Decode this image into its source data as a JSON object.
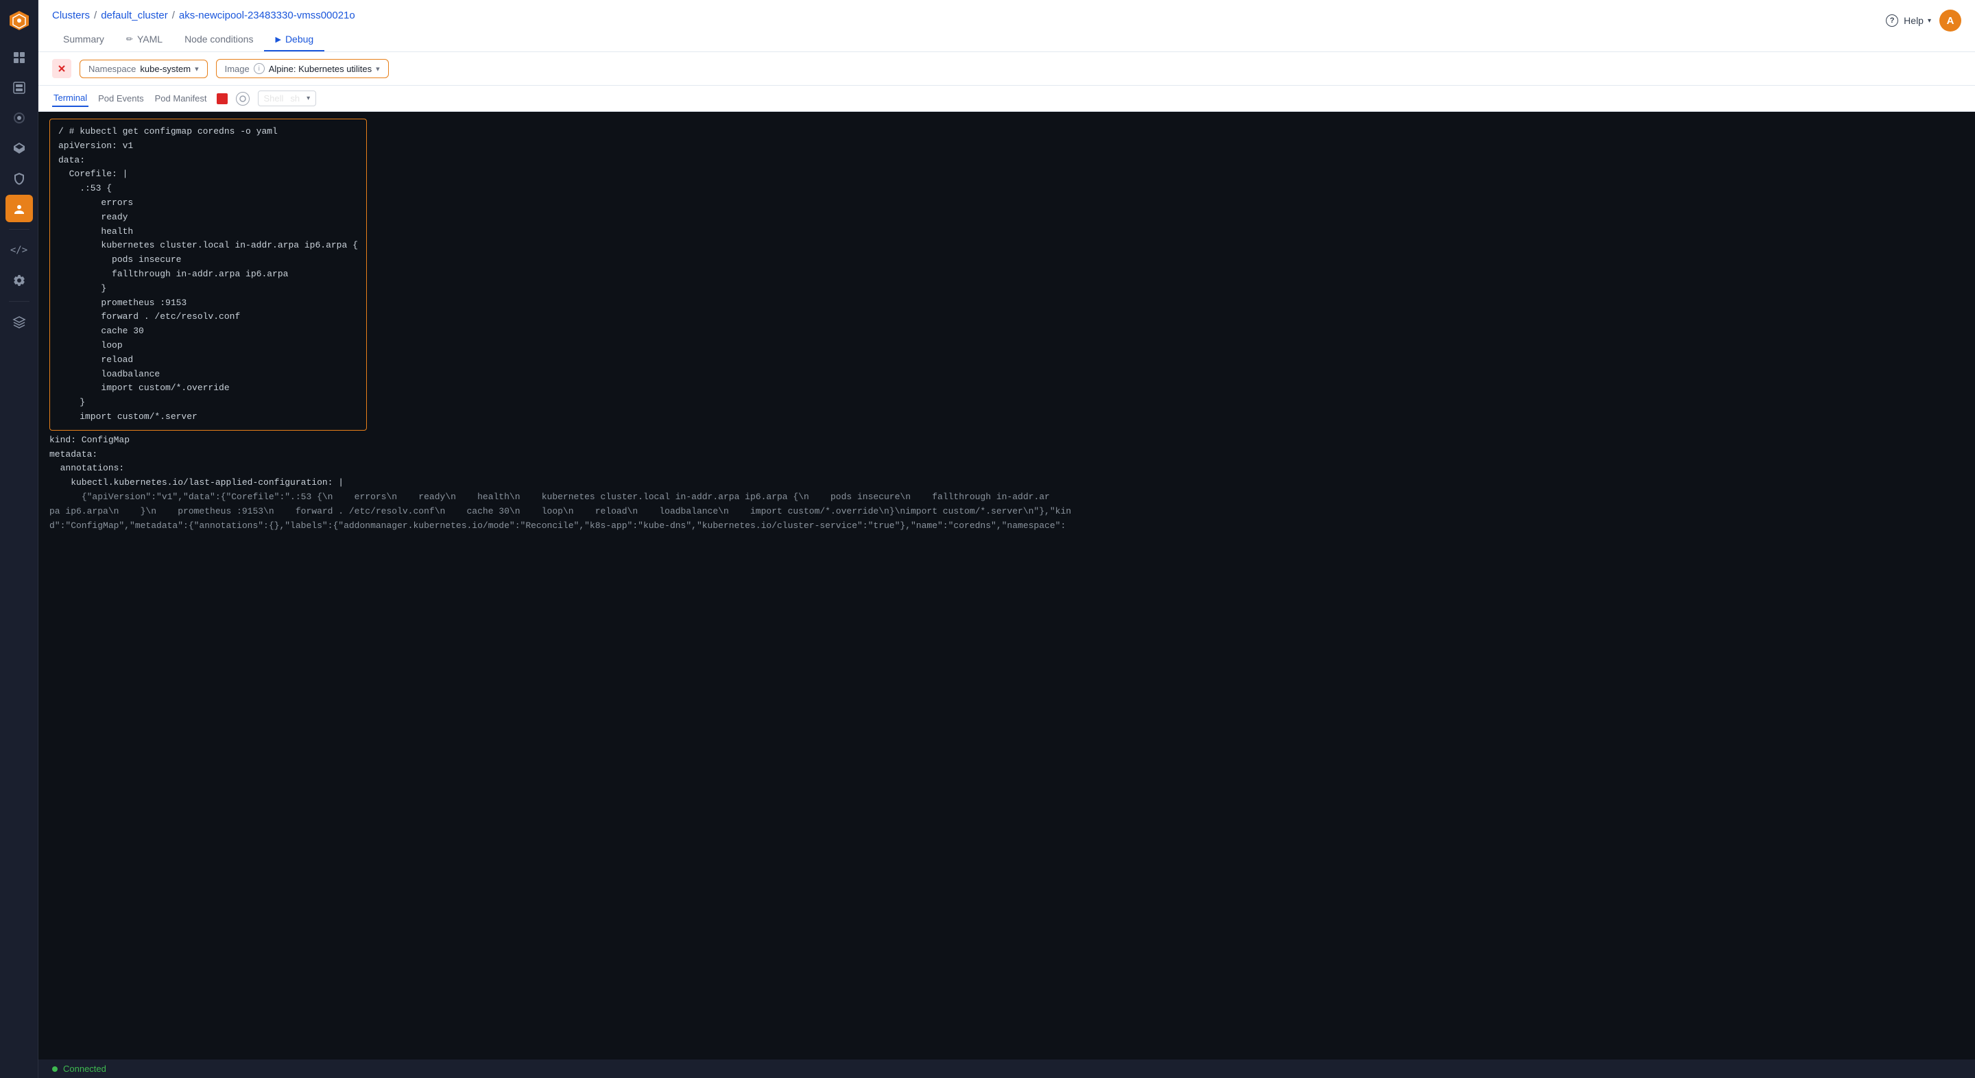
{
  "sidebar": {
    "logo_icon": "⬡",
    "items": [
      {
        "id": "dashboard",
        "icon": "⊞",
        "active": false
      },
      {
        "id": "nodes",
        "icon": "❑",
        "active": false
      },
      {
        "id": "settings",
        "icon": "⚙",
        "active": false
      },
      {
        "id": "deploy",
        "icon": "🚀",
        "active": false
      },
      {
        "id": "security",
        "icon": "🛡",
        "active": false
      },
      {
        "id": "debug",
        "icon": "👤",
        "active": true
      },
      {
        "id": "code",
        "icon": "</>",
        "active": false
      },
      {
        "id": "gear",
        "icon": "⚙",
        "active": false
      },
      {
        "id": "layers",
        "icon": "☰",
        "active": false
      }
    ]
  },
  "breadcrumb": {
    "parts": [
      "Clusters",
      "default_cluster",
      "aks-newcipool-23483330-vmss00021o"
    ],
    "separators": [
      "/",
      "/"
    ]
  },
  "tabs": [
    {
      "id": "summary",
      "label": "Summary",
      "active": false
    },
    {
      "id": "yaml",
      "label": "YAML",
      "active": false,
      "icon": "✏"
    },
    {
      "id": "node_conditions",
      "label": "Node conditions",
      "active": false
    },
    {
      "id": "debug",
      "label": "Debug",
      "active": true,
      "icon": "▶"
    }
  ],
  "toolbar": {
    "namespace_label": "Namespace",
    "namespace_value": "kube-system",
    "image_label": "Image",
    "image_value": "Alpine: Kubernetes utilites"
  },
  "terminal_tabs": [
    {
      "id": "terminal",
      "label": "Terminal",
      "active": true
    },
    {
      "id": "pod_events",
      "label": "Pod Events",
      "active": false
    },
    {
      "id": "pod_manifest",
      "label": "Pod Manifest",
      "active": false
    }
  ],
  "shell": {
    "label": "Shell",
    "value": "sh"
  },
  "terminal_content": {
    "highlighted_lines": [
      "/ # kubectl get configmap coredns -o yaml",
      "apiVersion: v1",
      "data:",
      "  Corefile: |",
      "    .:53 {",
      "        errors",
      "        ready",
      "        health",
      "        kubernetes cluster.local in-addr.arpa ip6.arpa {",
      "          pods insecure",
      "          fallthrough in-addr.arpa ip6.arpa",
      "        }",
      "        prometheus :9153",
      "        forward . /etc/resolv.conf",
      "        cache 30",
      "        loop",
      "        reload",
      "        loadbalance",
      "        import custom/*.override",
      "    }",
      "    import custom/*.server"
    ],
    "remaining_lines": [
      "kind: ConfigMap",
      "metadata:",
      "  annotations:",
      "    kubectl.kubernetes.io/last-applied-configuration: |",
      "      {\"apiVersion\":\"v1\",\"data\":{\"Corefile\":\".​:53 {\\n    errors\\n    ready\\n    health\\n    kubernetes cluster.local in-addr.arpa ip6.arpa {\\n    pods insecure\\n    fallthrough in-addr.ar",
      "pa ip6.arpa\\n    }\\n    prometheus :9153\\n    forward . /etc/resolv.conf\\n    cache 30\\n    loop\\n    reload\\n    loadbalance\\n    import custom/*.override\\n}\\nimport custom/*.server\\n\"},\"kin",
      "d\":\"ConfigMap\",\"metadata\":{\"annotations\":{},\"labels\":{\"addonmanager.kubernetes.io/mode\":\"Reconcile\",\"k8s-app\":\"kube-dns\",\"kubernetes.io/cluster-service\":\"true\"},\"name\":\"coredns\",\"namespace\":"
    ]
  },
  "status": {
    "text": "Connected",
    "color": "#3fb950"
  },
  "topbar_right": {
    "help_label": "Help",
    "avatar_initial": "A"
  }
}
